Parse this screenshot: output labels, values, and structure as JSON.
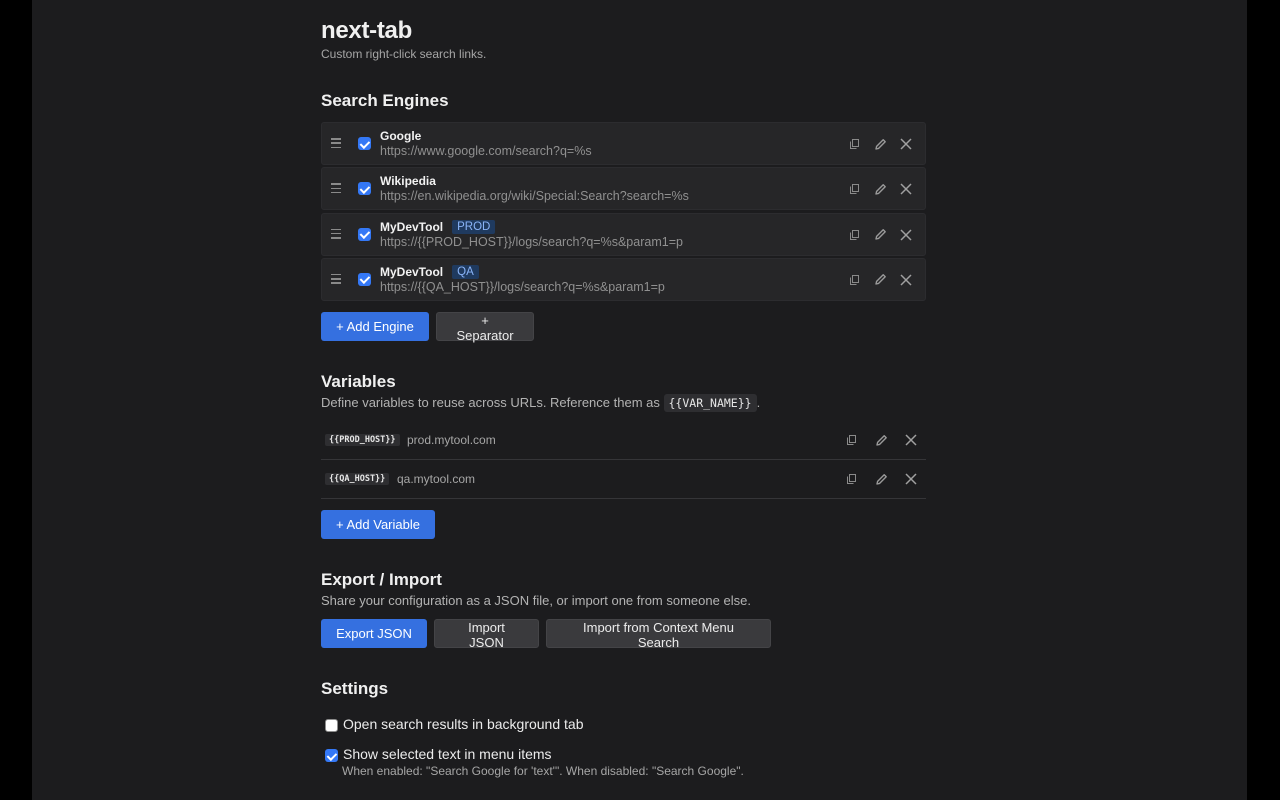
{
  "app": {
    "title": "next-tab",
    "subtitle": "Custom right-click search links."
  },
  "engines": {
    "title": "Search Engines",
    "items": [
      {
        "name": "Google",
        "badge": "",
        "url": "https://www.google.com/search?q=%s",
        "enabled": true
      },
      {
        "name": "Wikipedia",
        "badge": "",
        "url": "https://en.wikipedia.org/wiki/Special:Search?search=%s",
        "enabled": true
      },
      {
        "name": "MyDevTool",
        "badge": "PROD",
        "url": "https://{{PROD_HOST}}/logs/search?q=%s&param1=p",
        "enabled": true
      },
      {
        "name": "MyDevTool",
        "badge": "QA",
        "url": "https://{{QA_HOST}}/logs/search?q=%s&param1=p",
        "enabled": true
      }
    ],
    "add_engine_label": "+ Add Engine",
    "add_separator_label": "+ Separator"
  },
  "variables": {
    "title": "Variables",
    "desc_before": "Define variables to reuse across URLs. Reference them as ",
    "desc_code": "{{VAR_NAME}}",
    "desc_after": ".",
    "items": [
      {
        "key": "{{PROD_HOST}}",
        "value": "prod.mytool.com"
      },
      {
        "key": "{{QA_HOST}}",
        "value": "qa.mytool.com"
      }
    ],
    "add_label": "+ Add Variable"
  },
  "export_import": {
    "title": "Export / Import",
    "desc": "Share your configuration as a JSON file, or import one from someone else.",
    "export_label": "Export JSON",
    "import_label": "Import JSON",
    "import_cms_label": "Import from Context Menu Search"
  },
  "settings": {
    "title": "Settings",
    "background_tab": {
      "label": "Open search results in background tab",
      "checked": false
    },
    "show_selected": {
      "label": "Show selected text in menu items",
      "checked": true,
      "hint": "When enabled: \"Search Google for 'text'\". When disabled: \"Search Google\"."
    }
  },
  "icons": {
    "drag": "drag-handle-icon",
    "copy": "copy-icon",
    "edit": "pencil-icon",
    "delete": "close-icon"
  },
  "colors": {
    "accent": "#3570e0",
    "checkbox": "#3478f6",
    "badge_bg": "#1f3a5f",
    "badge_text": "#8ab4f8",
    "panel_bg": "#1c1c1e"
  }
}
